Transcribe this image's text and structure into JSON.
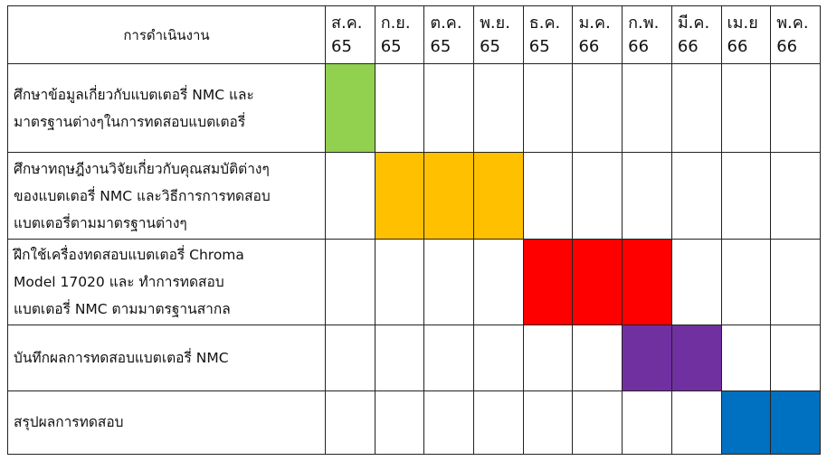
{
  "header": {
    "task_column": "การดำเนินงาน",
    "months": [
      {
        "month": "ส.ค.",
        "year": "65"
      },
      {
        "month": "ก.ย.",
        "year": "65"
      },
      {
        "month": "ต.ค.",
        "year": "65"
      },
      {
        "month": "พ.ย.",
        "year": "65"
      },
      {
        "month": "ธ.ค.",
        "year": "65"
      },
      {
        "month": "ม.ค.",
        "year": "66"
      },
      {
        "month": "ก.พ.",
        "year": "66"
      },
      {
        "month": "มี.ค.",
        "year": "66"
      },
      {
        "month": "เม.ย",
        "year": "66"
      },
      {
        "month": "พ.ค.",
        "year": "66"
      }
    ]
  },
  "tasks": [
    {
      "lines": [
        "ศึกษาข้อมูลเกี่ยวกับแบตเตอรี่ NMC และ",
        "มาตรฐานต่างๆในการทดสอบแบตเตอรี่"
      ],
      "active_months": [
        0
      ],
      "color": "#92d050"
    },
    {
      "lines": [
        "ศึกษาทฤษฎีงานวิจัยเกี่ยวกับคุณสมบัติต่างๆ",
        "ของแบตเตอรี่ NMC และวิธีการการทดสอบ",
        "แบตเตอรี่ตามมาตรฐานต่างๆ"
      ],
      "active_months": [
        1,
        2,
        3
      ],
      "color": "#ffc000"
    },
    {
      "lines": [
        "ฝึกใช้เครื่องทดสอบแบตเตอรี่ Chroma",
        "Model 17020 และ ทำการทดสอบ",
        "แบตเตอรี่ NMC ตามมาตรฐานสากล"
      ],
      "active_months": [
        4,
        5,
        6
      ],
      "color": "#ff0000"
    },
    {
      "lines": [
        "บันทึกผลการทดสอบแบตเตอรี่ NMC"
      ],
      "active_months": [
        6,
        7
      ],
      "color": "#7030a0"
    },
    {
      "lines": [
        "สรุปผลการทดสอบ"
      ],
      "active_months": [
        8,
        9
      ],
      "color": "#0070c0"
    }
  ]
}
